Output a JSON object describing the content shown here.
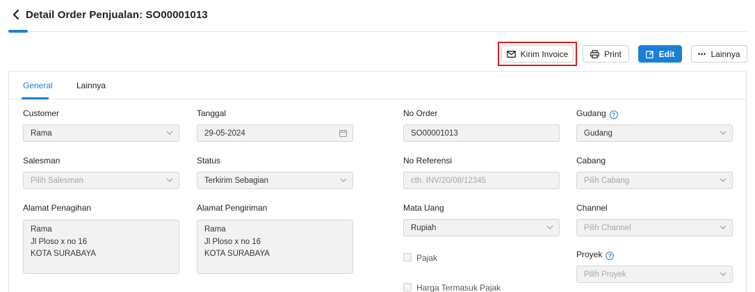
{
  "header": {
    "title": "Detail Order Penjualan: SO00001013"
  },
  "toolbar": {
    "kirim_invoice": "Kirim Invoice",
    "print": "Print",
    "edit": "Edit",
    "lainnya": "Lainnya"
  },
  "tabs": [
    {
      "label": "General",
      "active": true
    },
    {
      "label": "Lainnya",
      "active": false
    }
  ],
  "form": {
    "customer": {
      "label": "Customer",
      "value": "Rama"
    },
    "tanggal": {
      "label": "Tanggal",
      "value": "29-05-2024"
    },
    "no_order": {
      "label": "No Order",
      "value": "SO00001013"
    },
    "gudang": {
      "label": "Gudang",
      "value": "Gudang"
    },
    "salesman": {
      "label": "Salesman",
      "placeholder": "Pilih Salesman"
    },
    "status": {
      "label": "Status",
      "value": "Terkirim Sebagian"
    },
    "no_referensi": {
      "label": "No Referensi",
      "placeholder": "cth. INV/20/08/12345"
    },
    "cabang": {
      "label": "Cabang",
      "placeholder": "Pilih Cabang"
    },
    "alamat_penagihan": {
      "label": "Alamat Penagihan",
      "lines": [
        "Rama",
        "Jl Ploso x no 16",
        "KOTA SURABAYA"
      ]
    },
    "alamat_pengiriman": {
      "label": "Alamat Pengiriman",
      "lines": [
        "Rama",
        "Jl Ploso x no 16",
        "KOTA SURABAYA"
      ]
    },
    "mata_uang": {
      "label": "Mata Uang",
      "value": "Rupiah"
    },
    "channel": {
      "label": "Channel",
      "placeholder": "Pilih Channel"
    },
    "pajak": {
      "label": "Pajak",
      "checked": false
    },
    "harga_termasuk_pajak": {
      "label": "Harga Termasuk Pajak",
      "checked": false
    },
    "proyek": {
      "label": "Proyek",
      "placeholder": "Pilih Proyek"
    }
  },
  "colors": {
    "accent": "#1a7fd8",
    "highlight": "#e01b1b"
  },
  "icons": {
    "back": "chevron-left-icon",
    "kirim": "mail-icon",
    "print": "printer-icon",
    "edit": "edit-icon",
    "lainnya": "ellipsis-icon",
    "dropdown": "chevron-down-icon",
    "date": "calendar-icon",
    "help": "help-circle-icon"
  }
}
